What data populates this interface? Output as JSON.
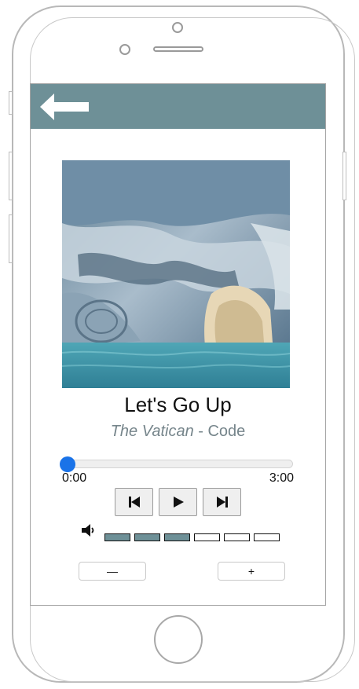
{
  "colors": {
    "header": "#6e9097",
    "accent": "#1a73e8",
    "volume_filled": "#6e9097",
    "meta_text": "#76858b"
  },
  "header": {
    "back_icon": "back-arrow-icon"
  },
  "artwork": {
    "description_icon": "album-art-image"
  },
  "song": {
    "title": "Let's Go Up",
    "artist": "The Vatican",
    "separator": " - ",
    "album": "Code"
  },
  "playback": {
    "current_time": "0:00",
    "total_time": "3:00",
    "progress": 0.0
  },
  "controls": {
    "previous_icon": "skip-previous-icon",
    "play_icon": "play-icon",
    "next_icon": "skip-next-icon"
  },
  "volume": {
    "icon": "speaker-icon",
    "level": 3,
    "max": 6
  },
  "volume_buttons": {
    "decrease_label": "—",
    "increase_label": "+"
  }
}
